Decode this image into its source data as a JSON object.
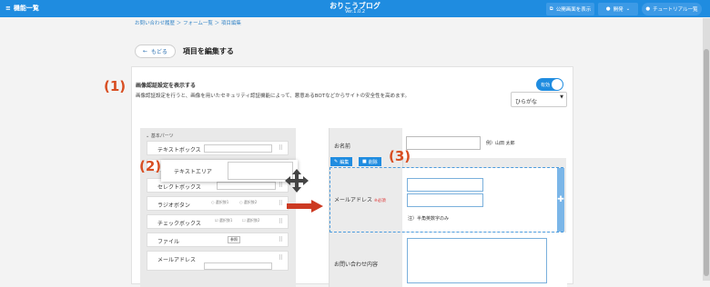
{
  "header": {
    "menu_label": "機能一覧",
    "app_name": "おりこうブログ",
    "version": "Ver.1.0.2",
    "btn_public_view": "公開画面を表示",
    "btn_developer": "開発",
    "btn_tutorial": "チュートリアル一覧"
  },
  "breadcrumb": "お問い合わせ履歴 ＞ フォーム一覧 ＞ 項目編集",
  "page": {
    "back_label": "もどる",
    "title": "項目を編集する"
  },
  "settings": {
    "heading": "画像認証設定を表示する",
    "description": "画像認証設定を行うと、画像を用いたセキュリティ認証機能によって、悪意あるBOTなどからサイトの安全性を高めます。",
    "toggle_label": "有効",
    "select_value": "ひらがな"
  },
  "parts": {
    "header": "基本パーツ",
    "items": [
      "テキストボックス",
      "セレクトボックス",
      "ラジオボタン",
      "チェックボックス",
      "ファイル",
      "メールアドレス"
    ],
    "option1": "選択肢1",
    "option2": "選択肢2",
    "file_label": "参照",
    "dragging": "テキストエリア"
  },
  "form": {
    "name_label": "お名前",
    "name_example": "例）山田 太郎",
    "edit_label": "編集",
    "delete_label": "削除",
    "email_label": "メールアドレス",
    "required": "※必須",
    "email_note": "注）半角英数字のみ",
    "inquiry_label": "お問い合わせ内容"
  },
  "annotations": {
    "a1": "(1)",
    "a2": "(2)",
    "a3": "(3)"
  },
  "colors": {
    "primary": "#1f8ce0",
    "annotation": "#d84e22",
    "arrow": "#cc3a22"
  }
}
